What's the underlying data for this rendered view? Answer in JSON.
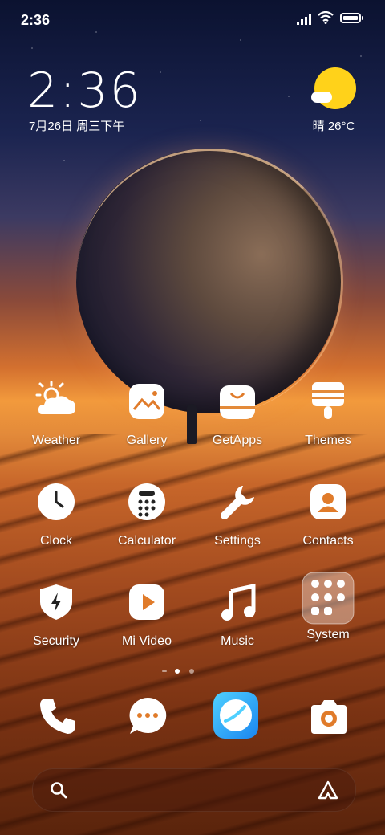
{
  "status_bar": {
    "time": "2:36"
  },
  "clock_widget": {
    "time": "2:36",
    "date": "7月26日 周三下午"
  },
  "weather_widget": {
    "condition_temp": "晴 26°C",
    "icon": "sunny-partly-cloudy-icon"
  },
  "apps": [
    {
      "label": "Weather",
      "icon": "weather-icon"
    },
    {
      "label": "Gallery",
      "icon": "gallery-icon"
    },
    {
      "label": "GetApps",
      "icon": "getapps-bag-icon"
    },
    {
      "label": "Themes",
      "icon": "themes-brush-icon"
    },
    {
      "label": "Clock",
      "icon": "clock-icon"
    },
    {
      "label": "Calculator",
      "icon": "calculator-icon"
    },
    {
      "label": "Settings",
      "icon": "wrench-icon"
    },
    {
      "label": "Contacts",
      "icon": "contacts-icon"
    },
    {
      "label": "Security",
      "icon": "shield-bolt-icon"
    },
    {
      "label": "Mi Video",
      "icon": "play-icon"
    },
    {
      "label": "Music",
      "icon": "music-note-icon"
    },
    {
      "label": "System",
      "icon": "system-folder-icon"
    }
  ],
  "dock": [
    {
      "icon": "phone-icon"
    },
    {
      "icon": "messages-icon"
    },
    {
      "icon": "browser-icon"
    },
    {
      "icon": "camera-icon"
    }
  ],
  "page_indicator": {
    "pages": 2,
    "current": 1
  },
  "search_bar": {
    "icon_left": "search-icon",
    "icon_right": "assistant-icon"
  }
}
